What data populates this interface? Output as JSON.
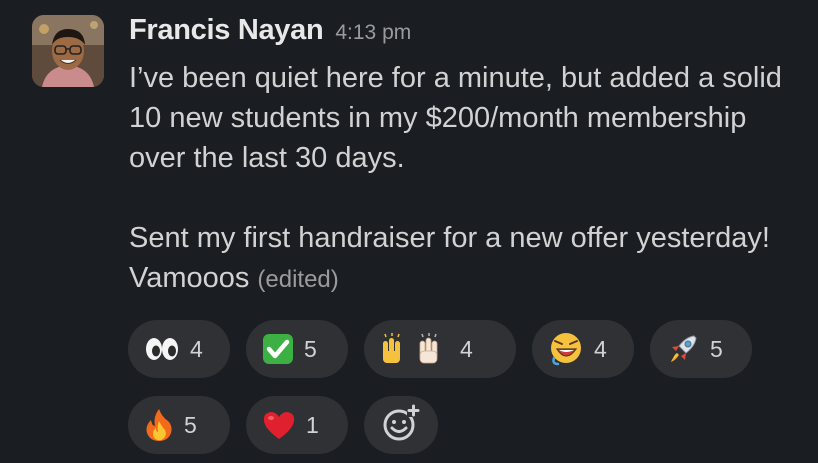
{
  "message": {
    "author": "Francis Nayan",
    "timestamp": "4:13 pm",
    "paragraph1": "I’ve been quiet here for a minute, but added a solid 10 new students in my $200/month membership over the last 30 days.",
    "paragraph2": "Sent my first handraiser for a new offer yesterday! Vamooos",
    "edited_label": "(edited)"
  },
  "reactions": [
    {
      "name": "eyes-icon",
      "count": "4"
    },
    {
      "name": "white-check-mark-icon",
      "count": "5"
    },
    {
      "name": "raised-hands-icon",
      "count": "4"
    },
    {
      "name": "laughing-face-icon",
      "count": "4"
    },
    {
      "name": "rocket-icon",
      "count": "5"
    },
    {
      "name": "fire-icon",
      "count": "5"
    },
    {
      "name": "heart-icon",
      "count": "1"
    }
  ],
  "colors": {
    "background": "#1a1d21",
    "reaction_pill": "#2f3134",
    "text": "#d1d2d3",
    "muted": "#9a9b9d"
  },
  "add_reaction_icon": "add-reaction-icon"
}
